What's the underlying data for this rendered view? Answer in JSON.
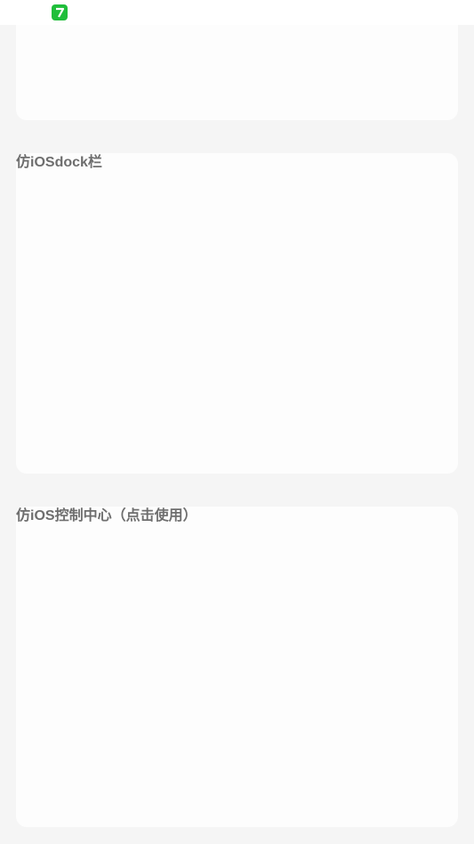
{
  "status_bar": {
    "app_icon": "app-notification-icon",
    "app_icon_color": "#1fbe3a"
  },
  "sections": {
    "dock": {
      "title": "仿iOSdock栏"
    },
    "control_center": {
      "title": "仿iOS控制中心（点击使用）"
    }
  },
  "colors": {
    "background": "#f5f5f5",
    "card": "#fdfdfd",
    "title_text": "#6e6e6e"
  }
}
